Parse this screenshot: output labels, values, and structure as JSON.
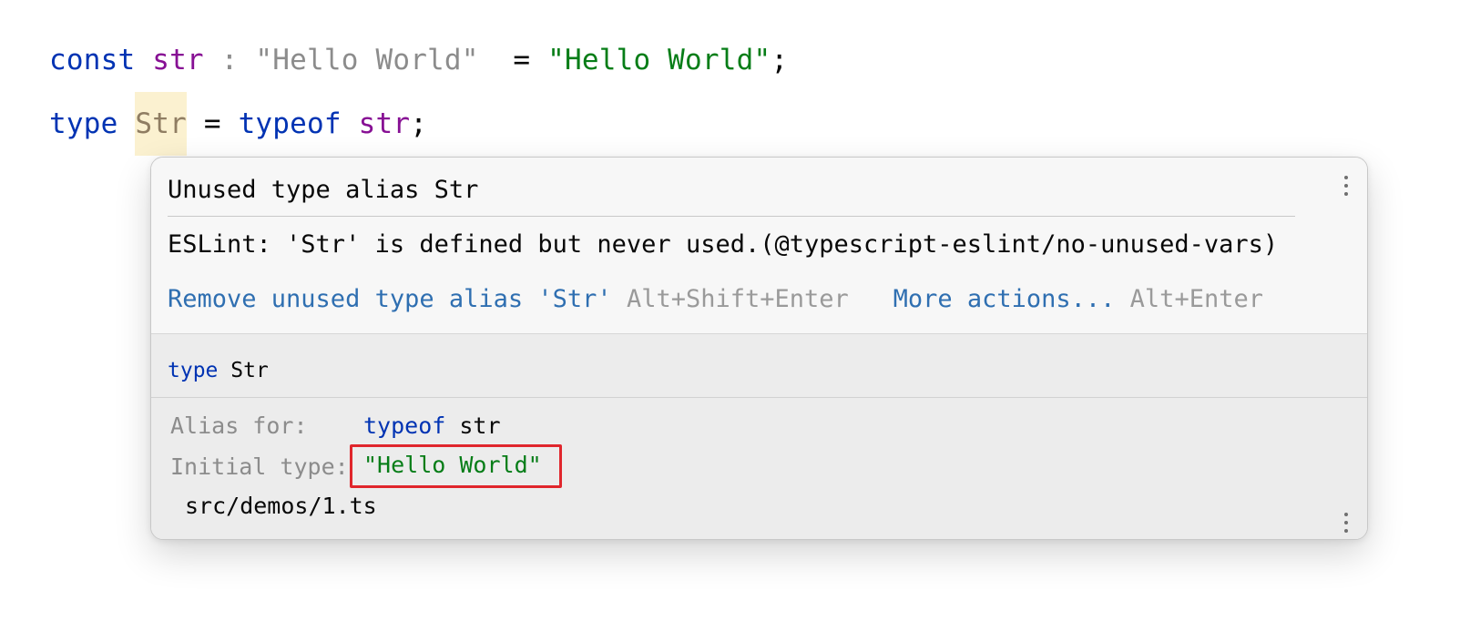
{
  "editor": {
    "line1": {
      "keyword": "const",
      "var_name": "str",
      "hint_colon": ":",
      "hint_type": "\"Hello World\"",
      "equals": "=",
      "value": "\"Hello World\"",
      "semicolon": ";"
    },
    "line2": {
      "keyword": "type",
      "type_name": "Str",
      "equals": "=",
      "typeof_kw": "typeof",
      "var_ref": "str",
      "semicolon": ";"
    }
  },
  "popup": {
    "title": "Unused type alias Str",
    "message": "ESLint: 'Str' is defined but never used.(@typescript-eslint/no-unused-vars)",
    "actions": [
      {
        "label": "Remove unused type alias 'Str'",
        "shortcut": "Alt+Shift+Enter"
      },
      {
        "label": "More actions...",
        "shortcut": "Alt+Enter"
      }
    ],
    "doc": {
      "def_keyword": "type",
      "def_name": "Str",
      "alias_label": "Alias for:",
      "alias_keyword": "typeof",
      "alias_ref": "str",
      "initial_label": "Initial type:",
      "initial_value": "\"Hello World\"",
      "file_path": "src/demos/1.ts"
    }
  },
  "colors": {
    "keyword": "#0033b3",
    "variable": "#871094",
    "string": "#067d17",
    "link": "#2f6fb1",
    "highlight_border": "#e0262c"
  }
}
